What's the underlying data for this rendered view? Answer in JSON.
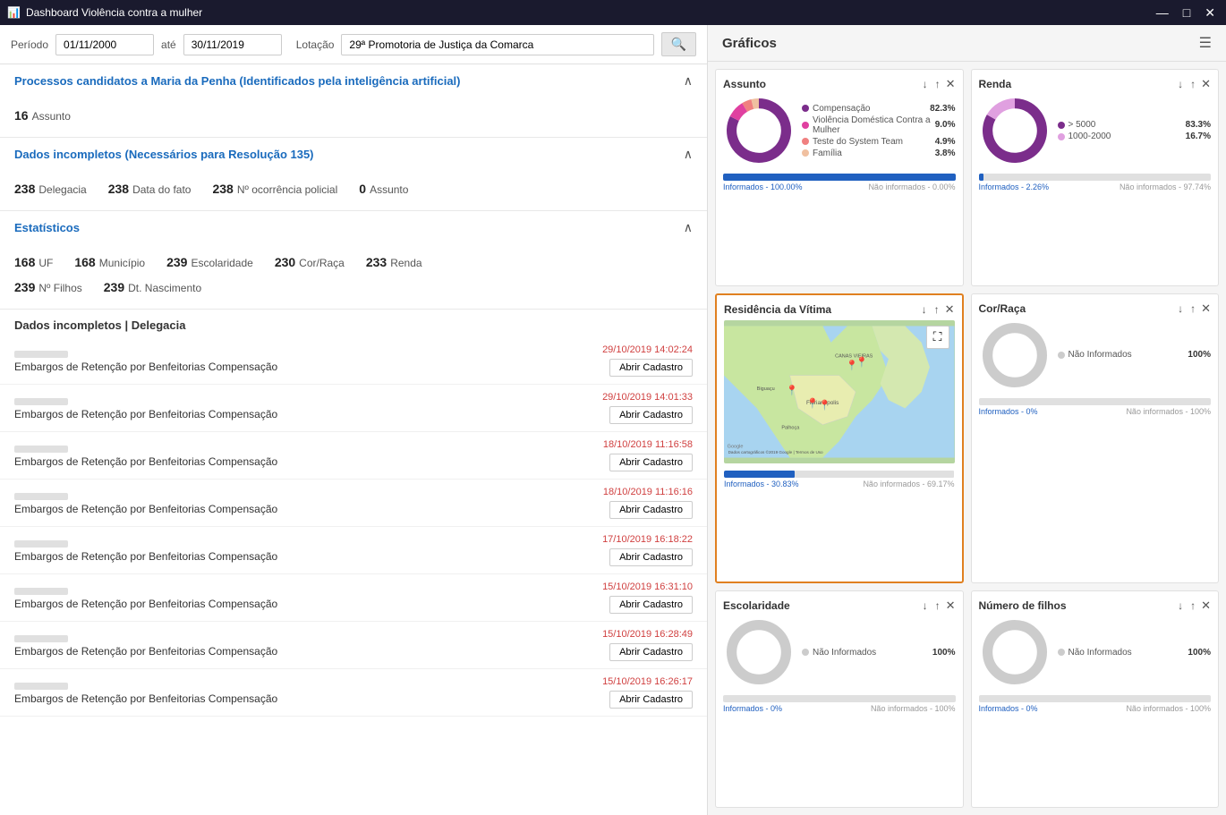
{
  "titlebar": {
    "title": "Dashboard Violência contra a mulher",
    "icon": "📊",
    "btn_minimize": "—",
    "btn_maximize": "□",
    "btn_close": "✕"
  },
  "filter": {
    "periodo_label": "Período",
    "from": "01/11/2000",
    "ate": "até",
    "to": "30/11/2019",
    "lotacao_label": "Lotação",
    "lotacao_value": "29ª Promotoria de Justiça da Comarca",
    "search_icon": "🔍"
  },
  "section1": {
    "title": "Processos candidatos a Maria da Penha (Identificados pela inteligência artificial)",
    "count": "16",
    "label": "Assunto"
  },
  "section2": {
    "title": "Dados incompletos (Necessários para Resolução 135)",
    "stats": [
      {
        "num": "238",
        "label": "Delegacia"
      },
      {
        "num": "238",
        "label": "Data do fato"
      },
      {
        "num": "238",
        "label": "Nº ocorrência policial"
      },
      {
        "num": "0",
        "label": "Assunto"
      }
    ]
  },
  "section3": {
    "title": "Estatísticos",
    "stats_row1": [
      {
        "num": "168",
        "label": "UF"
      },
      {
        "num": "168",
        "label": "Município"
      },
      {
        "num": "239",
        "label": "Escolaridade"
      },
      {
        "num": "230",
        "label": "Cor/Raça"
      },
      {
        "num": "233",
        "label": "Renda"
      }
    ],
    "stats_row2": [
      {
        "num": "239",
        "label": "Nº Filhos"
      },
      {
        "num": "239",
        "label": "Dt. Nascimento"
      }
    ]
  },
  "delegacia_section": {
    "title": "Dados incompletos | Delegacia"
  },
  "processes": [
    {
      "name": "Embargos de Retenção por Benfeitorias Compensação",
      "date": "29/10/2019 14:02:24",
      "btn": "Abrir Cadastro"
    },
    {
      "name": "Embargos de Retenção por Benfeitorias Compensação",
      "date": "29/10/2019 14:01:33",
      "btn": "Abrir Cadastro"
    },
    {
      "name": "Embargos de Retenção por Benfeitorias Compensação",
      "date": "18/10/2019 11:16:58",
      "btn": "Abrir Cadastro"
    },
    {
      "name": "Embargos de Retenção por Benfeitorias Compensação",
      "date": "18/10/2019 11:16:16",
      "btn": "Abrir Cadastro"
    },
    {
      "name": "Embargos de Retenção por Benfeitorias Compensação",
      "date": "17/10/2019 16:18:22",
      "btn": "Abrir Cadastro"
    },
    {
      "name": "Embargos de Retenção por Benfeitorias Compensação",
      "date": "15/10/2019 16:31:10",
      "btn": "Abrir Cadastro"
    },
    {
      "name": "Embargos de Retenção por Benfeitorias Compensação",
      "date": "15/10/2019 16:28:49",
      "btn": "Abrir Cadastro"
    },
    {
      "name": "Embargos de Retenção por Benfeitorias Compensação",
      "date": "15/10/2019 16:26:17",
      "btn": "Abrir Cadastro"
    }
  ],
  "graficos": {
    "title": "Gráficos",
    "cards": [
      {
        "id": "assunto",
        "title": "Assunto",
        "highlighted": false,
        "legend": [
          {
            "label": "Compensação",
            "pct": "82.3%",
            "color": "#7b2d8b"
          },
          {
            "label": "Violência Doméstica Contra a Mulher",
            "pct": "9.0%",
            "color": "#e040a0"
          },
          {
            "label": "Teste do System Team",
            "pct": "4.9%",
            "color": "#f08080"
          },
          {
            "label": "Família",
            "pct": "3.8%",
            "color": "#f0c0a0"
          }
        ],
        "bar_informed": "Informados - 100.00%",
        "bar_not_informed": "Não informados - 0.00%",
        "bar_informed_pct": 100
      },
      {
        "id": "renda",
        "title": "Renda",
        "highlighted": false,
        "legend": [
          {
            "label": "> 5000",
            "pct": "83.3%",
            "color": "#7b2d8b"
          },
          {
            "label": "1000-2000",
            "pct": "16.7%",
            "color": "#e0a0e0"
          }
        ],
        "bar_informed": "Informados - 2.26%",
        "bar_not_informed": "Não informados - 97.74%",
        "bar_informed_pct": 2.26
      },
      {
        "id": "residencia",
        "title": "Residência da Vítima",
        "highlighted": true,
        "map": true,
        "bar_informed": "Informados - 30.83%",
        "bar_not_informed": "Não informados - 69.17%",
        "bar_informed_pct": 30.83
      },
      {
        "id": "corraca",
        "title": "Cor/Raça",
        "highlighted": false,
        "legend": [
          {
            "label": "Não Informados",
            "pct": "100%",
            "color": "#cccccc"
          }
        ],
        "bar_informed": "Informados - 0%",
        "bar_not_informed": "Não informados - 100%",
        "bar_informed_pct": 0
      },
      {
        "id": "escolaridade",
        "title": "Escolaridade",
        "highlighted": false,
        "legend": [
          {
            "label": "Não Informados",
            "pct": "100%",
            "color": "#cccccc"
          }
        ],
        "bar_informed": "Informados - 0%",
        "bar_not_informed": "Não informados - 100%",
        "bar_informed_pct": 0
      },
      {
        "id": "num_filhos",
        "title": "Número de filhos",
        "highlighted": false,
        "legend": [
          {
            "label": "Não Informados",
            "pct": "100%",
            "color": "#cccccc"
          }
        ],
        "bar_informed": "Informados - 0%",
        "bar_not_informed": "Não informados - 100%",
        "bar_informed_pct": 0
      }
    ]
  }
}
